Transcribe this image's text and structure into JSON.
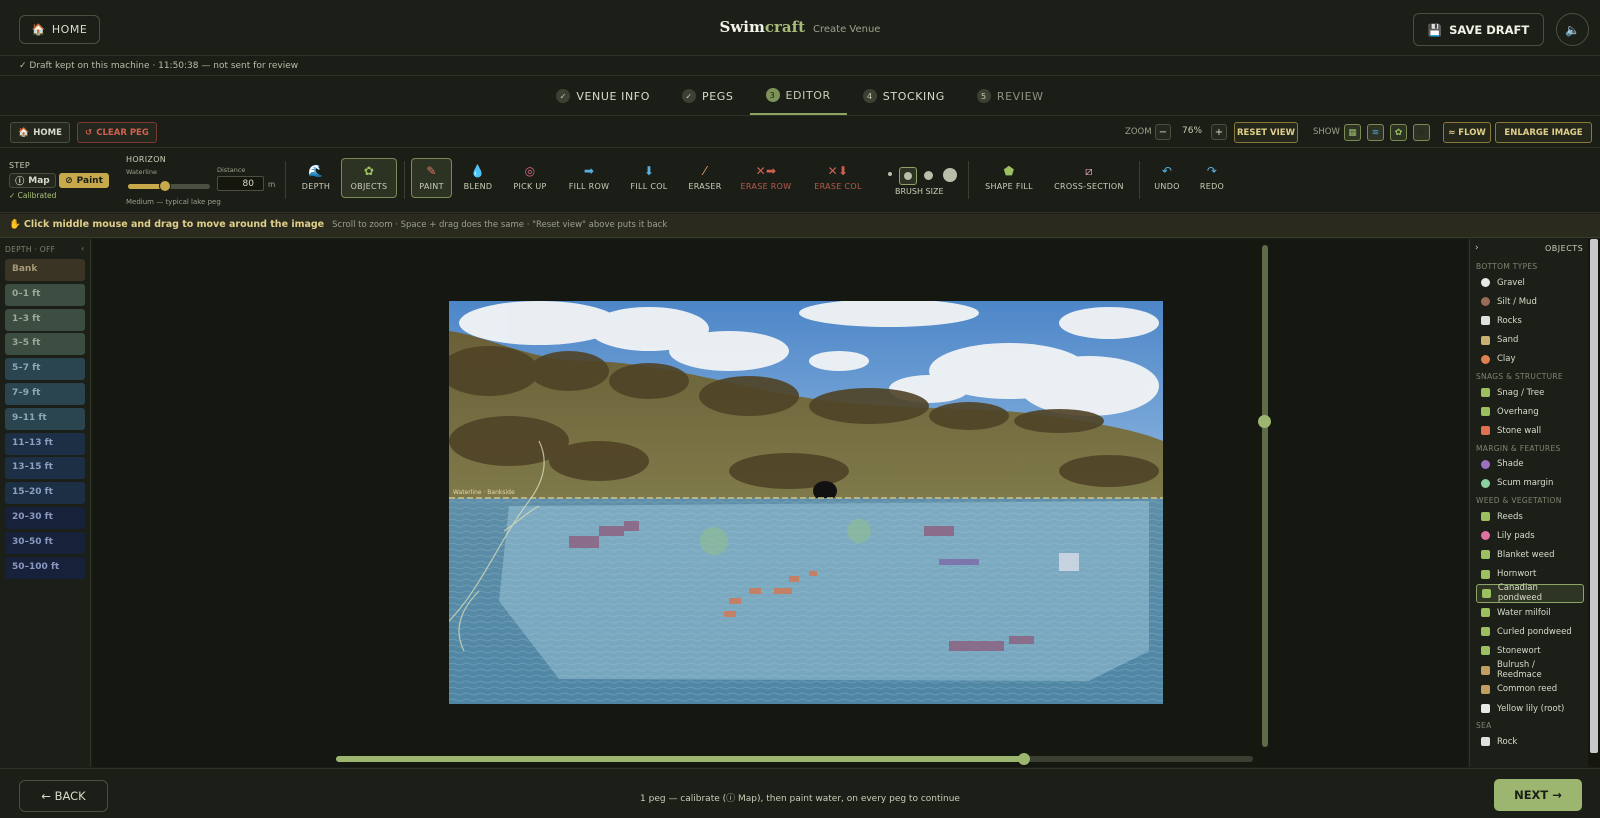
{
  "header": {
    "home_label": "HOME",
    "brand_part1": "Swim",
    "brand_part2": "craft",
    "subtitle": "Create Venue",
    "save_label": "SAVE DRAFT"
  },
  "status": "✓ Draft kept on this machine · 11:50:38 — not sent for review",
  "steps": [
    {
      "marker": "✓",
      "label": "VENUE INFO"
    },
    {
      "marker": "✓",
      "label": "PEGS"
    },
    {
      "marker": "3",
      "label": "EDITOR"
    },
    {
      "marker": "4",
      "label": "STOCKING"
    },
    {
      "marker": "5",
      "label": "REVIEW"
    }
  ],
  "toolbar": {
    "home_label": "HOME",
    "clear_peg_label": "CLEAR PEG",
    "zoom_label": "ZOOM",
    "zoom_value": "76%",
    "zoom_minus": "−",
    "zoom_plus": "+",
    "reset_view_label": "RESET VIEW",
    "show_label": "SHOW",
    "flow_label": "≈ FLOW",
    "enlarge_label": "ENLARGE IMAGE"
  },
  "editor": {
    "step_label": "STEP",
    "map_label": "Map",
    "paint_label": "Paint",
    "calibrated": "✓ Calibrated",
    "horizon_label": "HORIZON",
    "waterline_label": "Waterline",
    "waterline_level": 0.45,
    "waterline_hint": "Medium — typical lake peg",
    "distance_label": "Distance",
    "distance_value": "80",
    "distance_unit": "m",
    "tools": [
      {
        "label": "DEPTH",
        "icon": "wave-icon"
      },
      {
        "label": "OBJECTS",
        "icon": "plant-icon"
      },
      {
        "label": "PAINT",
        "icon": "pencil-icon"
      },
      {
        "label": "BLEND",
        "icon": "drop-icon"
      },
      {
        "label": "PICK UP",
        "icon": "target-icon"
      },
      {
        "label": "FILL ROW",
        "icon": "arrow-right-icon"
      },
      {
        "label": "FILL COL",
        "icon": "arrow-down-icon"
      },
      {
        "label": "ERASER",
        "icon": "eraser-icon"
      },
      {
        "label": "ERASE ROW",
        "icon": "erase-row-icon"
      },
      {
        "label": "ERASE COL",
        "icon": "erase-col-icon"
      },
      {
        "label": "BRUSH SIZE",
        "icon": "brush-size-icon"
      },
      {
        "label": "SHAPE FILL",
        "icon": "pentagon-icon"
      },
      {
        "label": "CROSS-SECTION",
        "icon": "cross-section-icon"
      },
      {
        "label": "UNDO",
        "icon": "undo-icon"
      },
      {
        "label": "REDO",
        "icon": "redo-icon"
      }
    ]
  },
  "hint": {
    "main": "Click middle mouse and drag to move around the image",
    "secondary": "Scroll to zoom · Space + drag does the same · \"Reset view\" above puts it back"
  },
  "depth_panel": {
    "header": "DEPTH · OFF",
    "items": [
      "Bank",
      "0–1 ft",
      "1–3 ft",
      "3–5 ft",
      "5–7 ft",
      "7–9 ft",
      "9–11 ft",
      "11–13 ft",
      "13–15 ft",
      "15–20 ft",
      "20–30 ft",
      "30–50 ft",
      "50–100 ft"
    ],
    "colors": {
      "bank": "#3a3424",
      "shallow": "#3c4d42",
      "mid": "#2a4450",
      "deep": "#1d2f45",
      "deepest": "#17223a"
    }
  },
  "canvas": {
    "waterline_tag": "Waterline · Bankside",
    "vertical_slider_level": 0.35,
    "horizontal_slider_level": 0.75
  },
  "objects_panel": {
    "header": "OBJECTS",
    "sections": [
      {
        "title": "BOTTOM TYPES",
        "items": [
          "Gravel",
          "Silt / Mud",
          "Rocks",
          "Sand",
          "Clay"
        ]
      },
      {
        "title": "SNAGS & STRUCTURE",
        "items": [
          "Snag / Tree",
          "Overhang",
          "Stone wall"
        ]
      },
      {
        "title": "MARGIN & FEATURES",
        "items": [
          "Shade",
          "Scum margin"
        ]
      },
      {
        "title": "WEED & VEGETATION",
        "items": [
          "Reeds",
          "Lily pads",
          "Blanket weed",
          "Hornwort",
          "Canadian pondweed",
          "Water milfoil",
          "Curled pondweed",
          "Stonewort",
          "Bulrush / Reedmace",
          "Common reed",
          "Yellow lily (root)"
        ]
      },
      {
        "title": "SEA",
        "items": [
          "Rock"
        ]
      }
    ],
    "selected": "Canadian pondweed"
  },
  "footer": {
    "back_label": "← BACK",
    "message": "1 peg — calibrate (ⓘ Map), then paint water, on every peg to continue",
    "next_label": "NEXT →"
  }
}
